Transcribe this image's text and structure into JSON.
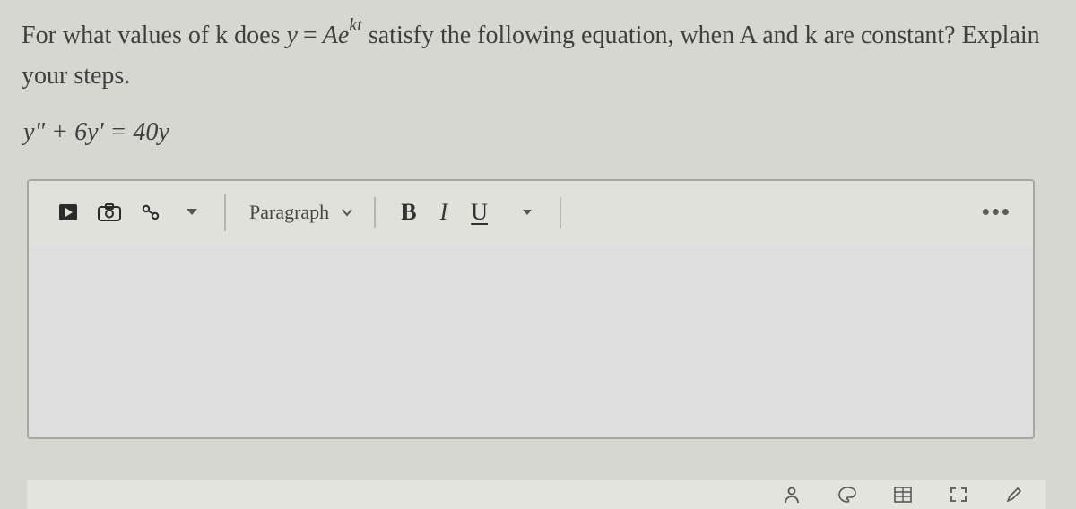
{
  "question": {
    "prefix": "For what values of k does ",
    "formula_y": "y",
    "formula_eq": "=",
    "formula_A": "A",
    "formula_e": "e",
    "formula_exp": "kt",
    "mid": " satisfy the following equation, when A and k are constant?  Explain your steps.",
    "ode": "y\" + 6y' = 40y"
  },
  "toolbar": {
    "play_icon": "play-icon",
    "camera_icon": "camera-icon",
    "attach_icon": "attachment-icon",
    "dropdown_caret": "▼",
    "paragraph_label": "Paragraph",
    "bold_label": "B",
    "italic_label": "I",
    "underline_label": "U",
    "more_label": "•••"
  },
  "bottombar": {
    "icons": [
      "user-icon",
      "palette-icon",
      "table-icon",
      "expand-icon",
      "pencil-icon"
    ]
  }
}
